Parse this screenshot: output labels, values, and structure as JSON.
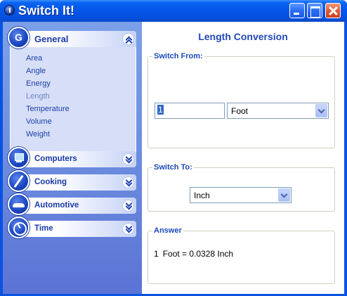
{
  "window": {
    "title": "Switch It!",
    "controls": {
      "minimize": "minimize",
      "maximize": "maximize",
      "close": "close"
    }
  },
  "sidebar": {
    "groups": [
      {
        "title": "General",
        "icon": "g-letter-icon",
        "icon_text": "G",
        "expanded": true,
        "items": [
          {
            "label": "Area",
            "active": false
          },
          {
            "label": "Angle",
            "active": false
          },
          {
            "label": "Energy",
            "active": false
          },
          {
            "label": "Length",
            "active": true
          },
          {
            "label": "Temperature",
            "active": false
          },
          {
            "label": "Volume",
            "active": false
          },
          {
            "label": "Weight",
            "active": false
          }
        ]
      },
      {
        "title": "Computers",
        "icon": "computer-icon",
        "expanded": false
      },
      {
        "title": "Cooking",
        "icon": "cooking-icon",
        "expanded": false
      },
      {
        "title": "Automotive",
        "icon": "car-icon",
        "expanded": false
      },
      {
        "title": "Time",
        "icon": "clock-icon",
        "expanded": false
      }
    ]
  },
  "main": {
    "title": "Length Conversion",
    "switch_from": {
      "legend": "Switch From:",
      "value": "1",
      "unit": "Foot"
    },
    "switch_to": {
      "legend": "Switch To:",
      "unit": "Inch"
    },
    "answer": {
      "legend": "Answer",
      "quantity": "1",
      "text": "Foot = 0.0328 Inch"
    }
  },
  "colors": {
    "title_bar": "#0556e8",
    "sidebar": "#6e8fe0",
    "heading": "#2149b8",
    "legend": "#1c4ab8",
    "close_button": "#e55b33"
  }
}
